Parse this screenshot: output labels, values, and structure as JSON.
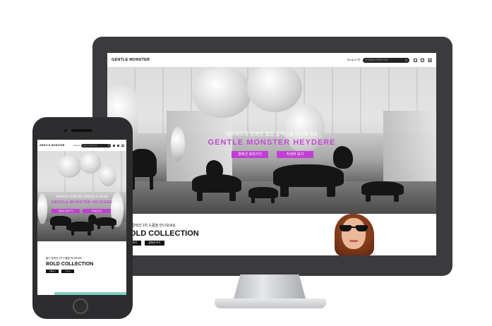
{
  "desktop": {
    "brand": "GENTLE MONSTER",
    "shop_link": "Shop in 한",
    "search_placeholder": "검색창을 입력해주세요",
    "hero": {
      "subtitle": "데이제르와 함께한 협업 컬렉션을 만나보세요",
      "title": "GENTLE MONSTER  HEYDERE",
      "button_collection": "컬렉션 보러가기",
      "button_details": "자세히 보기"
    },
    "promo": {
      "small_text": "볼드 컬렉션 2차 드롭을 만나보세요",
      "heading": "BOLD COLLECTION",
      "button_view": "구매하기",
      "button_more": "컬렉션 보기"
    }
  },
  "mobile": {
    "brand": "GENTLE MONSTER",
    "shop_link": "Shop in",
    "search_placeholder": "검색창을 입력해주세요",
    "hero": {
      "subtitle": "데이제르와 함께한 협업 컬렉션을 만나보세요",
      "title": "GENTLE MONSTER  HEYDERE",
      "button_collection": "컬렉션 보러가기",
      "button_details": "자세히 보기"
    },
    "promo": {
      "small_text": "볼드 컬렉션 2차 드롭을 만나보세요",
      "heading": "BOLD COLLECTION",
      "button_view": "구매하기",
      "button_more": "더 보기"
    }
  },
  "colors": {
    "accent": "#c23fd4",
    "device_frame": "#3b3b3d",
    "header_bg": "#ffffff"
  }
}
